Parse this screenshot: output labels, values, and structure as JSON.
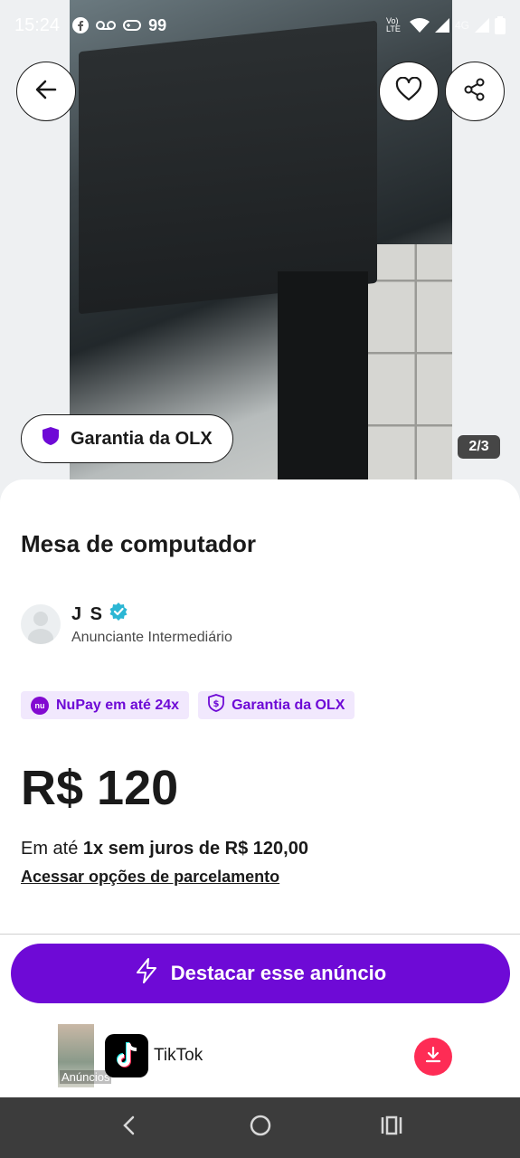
{
  "statusbar": {
    "time": "15:24",
    "notif_count": "99",
    "network_label": "Vo) LTE",
    "signal_label": "4G"
  },
  "photo": {
    "counter": "2/3",
    "garantia_chip": "Garantia da OLX"
  },
  "listing": {
    "title": "Mesa de computador",
    "seller_name": "J S",
    "seller_level": "Anunciante Intermediário",
    "tags": [
      "NuPay em até 24x",
      "Garantia da OLX"
    ],
    "price": "R$ 120",
    "install_prefix": "Em até ",
    "install_bold": "1x sem juros de R$ 120,00",
    "install_link": "Acessar opções de parcelamento"
  },
  "cta": {
    "label": "Destacar esse anúncio"
  },
  "ad": {
    "label": "Anúncios",
    "name": "TikTok"
  },
  "colors": {
    "brand": "#6e0ad6",
    "tag_bg": "#f1e8fd",
    "verified": "#2bb6d4",
    "tiktok_download": "#fe2c55"
  }
}
